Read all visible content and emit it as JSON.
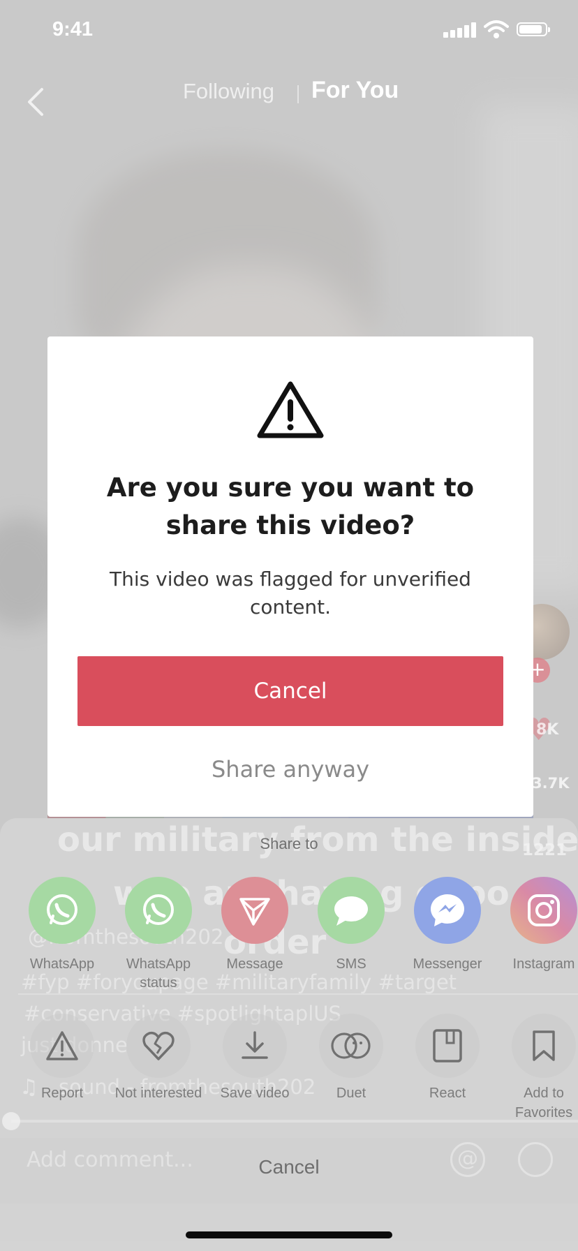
{
  "status_bar": {
    "time": "9:41",
    "icons": [
      "signal-icon",
      "wifi-icon",
      "battery-icon"
    ]
  },
  "top_nav": {
    "back_icon": "chevron-left-icon",
    "tabs": [
      {
        "label": "Following",
        "active": false
      },
      {
        "label": "For You",
        "active": true
      }
    ]
  },
  "video": {
    "caption_lines": [
      "our military from the inside",
      "who are having oppo",
      "order"
    ],
    "username": "@fromthesouth202",
    "hashtags": [
      "#fyp #foryoupage #militaryfamily #target",
      "#conservative #spotlightaplUS",
      "just donne"
    ],
    "sound": "sound - fromthesouth202",
    "rail_counts": [
      "8K",
      "3.7K",
      "1221"
    ],
    "comment_placeholder": "Add comment...",
    "comment_icons": [
      "at-icon",
      "emoji-icon"
    ]
  },
  "modal": {
    "icon": "warning-icon",
    "title": "Are you sure you want to share this video?",
    "message": "This video was flagged for unverified content.",
    "cancel_label": "Cancel",
    "share_label": "Share anyway",
    "colors": {
      "cancel_bg": "#d94e5c",
      "title": "#1d1d1d"
    }
  },
  "share_sheet": {
    "title": "Share to",
    "apps": [
      {
        "label": "WhatsApp",
        "icon": "whatsapp-icon",
        "color": "#a6d9a3"
      },
      {
        "label": "WhatsApp status",
        "icon": "whatsapp-icon",
        "color": "#a6d9a3"
      },
      {
        "label": "Message",
        "icon": "paper-plane-icon",
        "color": "#dd8f96"
      },
      {
        "label": "SMS",
        "icon": "chat-bubble-icon",
        "color": "#a6d9a3"
      },
      {
        "label": "Messenger",
        "icon": "messenger-icon",
        "color": "#8fa5e6"
      },
      {
        "label": "Instagram",
        "icon": "instagram-icon",
        "color": "#d99ab5"
      }
    ],
    "actions": [
      {
        "label": "Report",
        "icon": "warning-icon"
      },
      {
        "label": "Not interested",
        "icon": "broken-heart-icon"
      },
      {
        "label": "Save video",
        "icon": "download-icon"
      },
      {
        "label": "Duet",
        "icon": "duet-icon"
      },
      {
        "label": "React",
        "icon": "react-icon"
      },
      {
        "label": "Add to Favorites",
        "icon": "bookmark-icon"
      }
    ],
    "cancel_label": "Cancel"
  }
}
